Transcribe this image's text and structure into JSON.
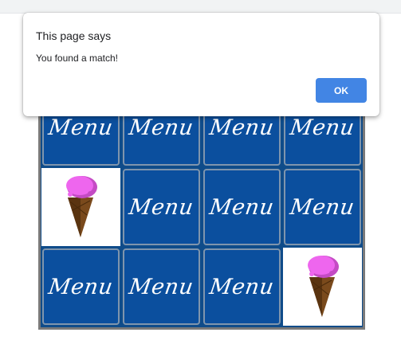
{
  "dialog": {
    "title": "This page says",
    "message": "You found a match!",
    "ok_label": "OK"
  },
  "board": {
    "rows": [
      [
        {
          "state": "back",
          "label": "Menu"
        },
        {
          "state": "back",
          "label": "Menu"
        },
        {
          "state": "back",
          "label": "Menu"
        },
        {
          "state": "back",
          "label": "Menu"
        }
      ],
      [
        {
          "state": "face",
          "icon": "ice-cream-cone-icon"
        },
        {
          "state": "back",
          "label": "Menu"
        },
        {
          "state": "back",
          "label": "Menu"
        },
        {
          "state": "back",
          "label": "Menu"
        }
      ],
      [
        {
          "state": "back",
          "label": "Menu"
        },
        {
          "state": "back",
          "label": "Menu"
        },
        {
          "state": "back",
          "label": "Menu"
        },
        {
          "state": "face",
          "icon": "ice-cream-cone-icon"
        }
      ]
    ]
  },
  "colors": {
    "card_back": "#0b4f9e",
    "board_border": "#7a7a7a",
    "ok_button": "#4285e4",
    "ice_cream_scoop": "#ee66ee",
    "cone": "#7a4a1c"
  }
}
